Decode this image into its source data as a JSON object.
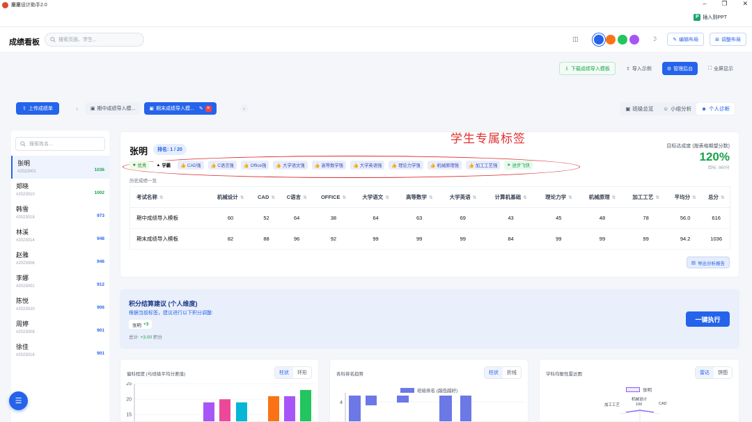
{
  "window": {
    "title": "鏖鏖设计助手2.0",
    "insert_ppt": "插入到PPT"
  },
  "header": {
    "brand": "成绩看板",
    "search_placeholder": "搜索页面、学生...",
    "edit_layout": "编辑布局",
    "adjust_layout": "调整布局",
    "theme_colors": [
      "#2563eb",
      "#f97316",
      "#22c55e",
      "#a855f7"
    ]
  },
  "toolbar": {
    "download": "下载成绩导入模板",
    "import_example": "导入示例",
    "admin": "管理后台",
    "fullscreen": "全屏显示"
  },
  "files": {
    "upload": "上传成绩单",
    "tabs": [
      "期中成绩导入模...",
      "期末成绩导入模..."
    ]
  },
  "views": [
    "班级总览",
    "小组分析",
    "个人诊断"
  ],
  "sidebar": {
    "search_placeholder": "搜索姓名...",
    "students": [
      {
        "name": "张明",
        "id": "#2023001",
        "score": "1036"
      },
      {
        "name": "郑晓",
        "id": "#2023010",
        "score": "1002"
      },
      {
        "name": "韩雪",
        "id": "#2023018",
        "score": "973"
      },
      {
        "name": "林溪",
        "id": "#2023014",
        "score": "948"
      },
      {
        "name": "赵雅",
        "id": "#2023006",
        "score": "946"
      },
      {
        "name": "李娜",
        "id": "#2023002",
        "score": "912"
      },
      {
        "name": "陈悦",
        "id": "#2023020",
        "score": "906"
      },
      {
        "name": "周婷",
        "id": "#2023008",
        "score": "901"
      },
      {
        "name": "徐佳",
        "id": "#2023016",
        "score": "901"
      }
    ]
  },
  "student": {
    "name": "张明",
    "rank": "排名: 1 / 20",
    "tags": [
      "优秀",
      "学霸",
      "CAD强",
      "C语言强",
      "Office强",
      "大学语文强",
      "高等数学强",
      "大学英语强",
      "理论力学强",
      "机械原理强",
      "加工工艺强",
      "进步飞快"
    ],
    "annotation": "学生专属标签",
    "goal_label": "目标达成度 (按表格期望分数)",
    "goal_value": "120%",
    "goal_sub": "目标: 860分",
    "history_label": "历史成绩一览",
    "columns": [
      "考试名称",
      "机械设计",
      "CAD",
      "C语言",
      "OFFICE",
      "大学语文",
      "高等数学",
      "大学英语",
      "计算机基础",
      "理论力学",
      "机械原理",
      "加工工艺",
      "平均分",
      "总分"
    ],
    "rows": [
      [
        "期中成绩导入模板",
        "60",
        "52",
        "64",
        "38",
        "64",
        "63",
        "69",
        "43",
        "45",
        "48",
        "78",
        "56.0",
        "616"
      ],
      [
        "期末成绩导入模板",
        "82",
        "88",
        "96",
        "92",
        "99",
        "99",
        "99",
        "84",
        "99",
        "99",
        "99",
        "94.2",
        "1036"
      ]
    ],
    "export": "导出分析报告"
  },
  "advice": {
    "title": "积分结算建议 (个人维度)",
    "subtitle": "根据当前标签，建议进行以下积分调整:",
    "chip_name": "张明",
    "chip_value": "+3",
    "total_label": "总计:",
    "total_value": "+3.00",
    "total_unit": "积分",
    "execute": "一键执行"
  },
  "panels": {
    "p1": {
      "title": "偏科程度 (与班级平均分差值)",
      "tabs": [
        "柱状",
        "环形"
      ]
    },
    "p2": {
      "title": "各科排名趋势",
      "tabs": [
        "柱状",
        "折线"
      ],
      "legend": "班级排名 (越低越好)"
    },
    "p3": {
      "title": "学科均衡性雷达图",
      "tabs": [
        "雷达",
        "饼图"
      ],
      "legend": "张明",
      "radar_labels": [
        "机械设计",
        "100",
        "加工工艺",
        "CAD"
      ]
    }
  },
  "chart_data": [
    {
      "type": "bar",
      "title": "偏科程度 (与班级平均分差值)",
      "ylim": [
        0,
        25
      ],
      "yticks": [
        25,
        20,
        15
      ],
      "values": [
        19,
        20,
        19,
        21,
        21,
        23
      ],
      "colors": [
        "#a855f7",
        "#ec4899",
        "#06b6d4",
        "#f97316",
        "#a855f7",
        "#22c55e"
      ]
    },
    {
      "type": "bar",
      "title": "各科排名趋势",
      "yticks": [
        4
      ],
      "series": [
        {
          "name": "班级排名 (越低越好)",
          "values": [
            4,
            3,
            2,
            4,
            4
          ]
        }
      ]
    }
  ]
}
